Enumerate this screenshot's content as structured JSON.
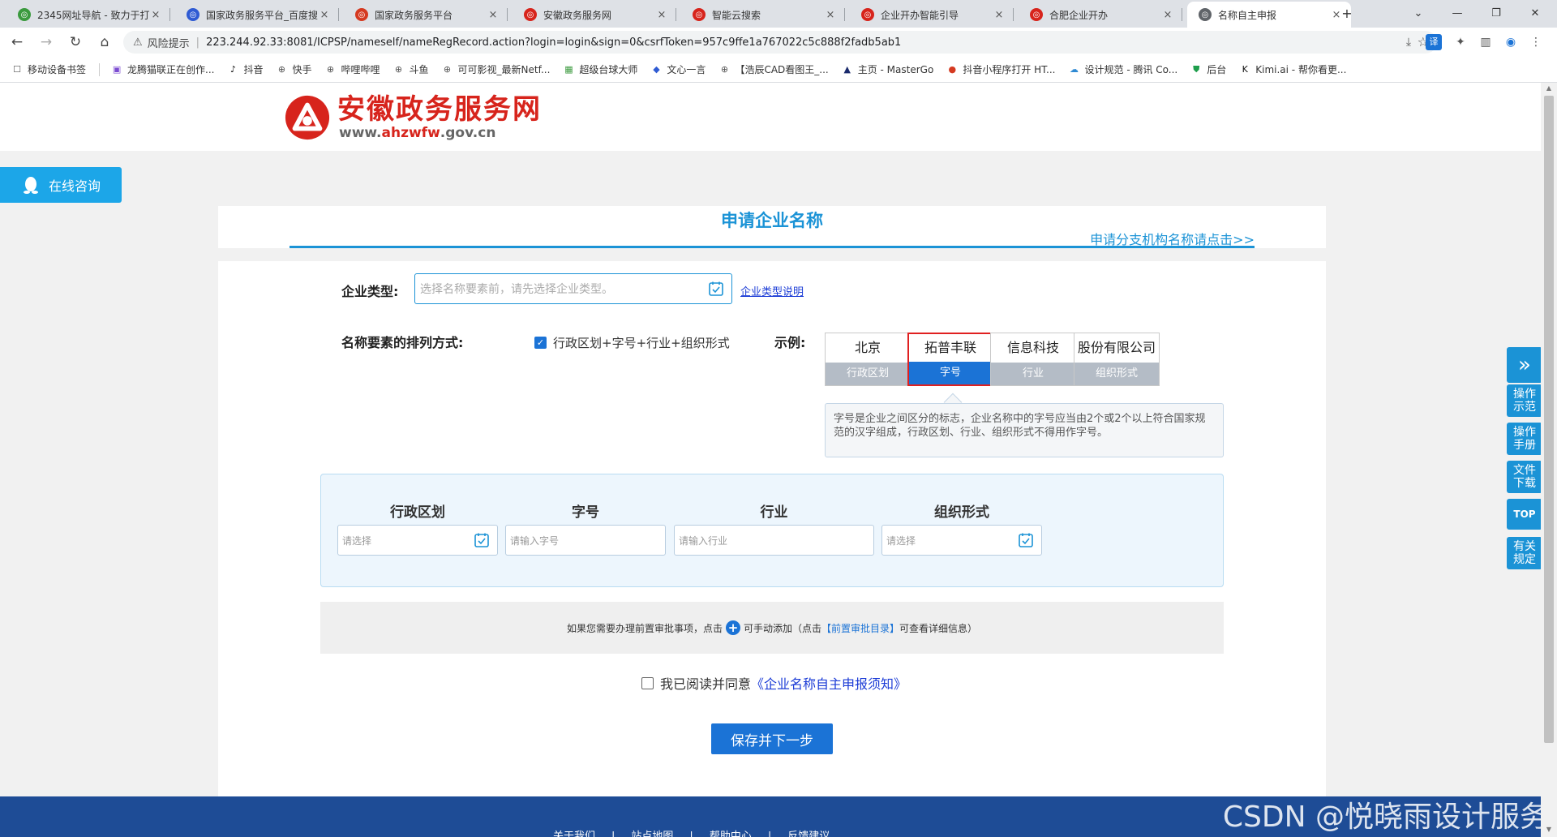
{
  "browser": {
    "tabs": [
      {
        "title": "2345网址导航 - 致力于打",
        "icon_color": "#3b9a3e"
      },
      {
        "title": "国家政务服务平台_百度搜",
        "icon_color": "#2f5bd3"
      },
      {
        "title": "国家政务服务平台",
        "icon_color": "#d53a21"
      },
      {
        "title": "安徽政务服务网",
        "icon_color": "#d7241c"
      },
      {
        "title": "智能云搜索",
        "icon_color": "#d7241c"
      },
      {
        "title": "企业开办智能引导",
        "icon_color": "#d7241c"
      },
      {
        "title": "合肥企业开办",
        "icon_color": "#d7241c"
      },
      {
        "title": "名称自主申报",
        "icon_color": "#5f6368"
      }
    ],
    "close_glyph": "×",
    "new_tab_glyph": "+",
    "security_label": "风险提示",
    "url": "223.244.92.33:8081/ICPSP/nameself/nameRegRecord.action?login=login&sign=0&csrfToken=957c9ffe1a767022c5c888f2fadb5ab1",
    "bookmarks": [
      {
        "label": "移动设备书签",
        "icon": "folder-icon"
      },
      {
        "label": "龙腾猫联正在创作...",
        "icon": "bookmark-icon"
      },
      {
        "label": "抖音",
        "icon": "tiktok-icon"
      },
      {
        "label": "快手",
        "icon": "globe-icon"
      },
      {
        "label": "哔哩哔哩",
        "icon": "globe-icon"
      },
      {
        "label": "斗鱼",
        "icon": "globe-icon"
      },
      {
        "label": "可可影视_最新Netf...",
        "icon": "globe-icon"
      },
      {
        "label": "超级台球大师",
        "icon": "game-icon"
      },
      {
        "label": "文心一言",
        "icon": "wenxin-icon"
      },
      {
        "label": "【浩辰CAD看图王_...",
        "icon": "globe-icon"
      },
      {
        "label": "主页 - MasterGo",
        "icon": "mastergo-icon"
      },
      {
        "label": "抖音小程序打开 HT...",
        "icon": "person-icon"
      },
      {
        "label": "设计规范 - 腾讯 Co...",
        "icon": "tencent-icon"
      },
      {
        "label": "后台",
        "icon": "shield-icon"
      },
      {
        "label": "Kimi.ai - 帮你看更...",
        "icon": "kimi-icon"
      }
    ]
  },
  "site": {
    "logo_cn": "安徽政务服务网",
    "logo_en_prefix": "www.",
    "logo_en_brand": "ahzwfw",
    "logo_en_suffix": ".gov.cn",
    "brand_color": "#d7241c",
    "online_consult": "在线咨询",
    "page_title": "申请企业名称",
    "branch_link": "申请分支机构名称请点击>>"
  },
  "form": {
    "type_label": "企业类型:",
    "type_placeholder": "选择名称要素前，请先选择企业类型。",
    "type_help": "企业类型说明",
    "order_label": "名称要素的排列方式:",
    "order_option": "行政区划+字号+行业+组织形式",
    "order_checked": true,
    "example_label": "示例:",
    "examples": [
      {
        "value": "北京",
        "tag": "行政区划",
        "highlight": false
      },
      {
        "value": "拓普丰联",
        "tag": "字号",
        "highlight": true
      },
      {
        "value": "信息科技",
        "tag": "行业",
        "highlight": false
      },
      {
        "value": "股份有限公司",
        "tag": "组织形式",
        "highlight": false
      }
    ],
    "example_tip": "字号是企业之间区分的标志，企业名称中的字号应当由2个或2个以上符合国家规范的汉字组成，行政区划、行业、组织形式不得用作字号。",
    "elements": [
      {
        "header": "行政区划",
        "placeholder": "请选择",
        "has_picker": true
      },
      {
        "header": "字号",
        "placeholder": "请输入字号",
        "has_picker": false
      },
      {
        "header": "行业",
        "placeholder": "请输入行业",
        "has_picker": false
      },
      {
        "header": "组织形式",
        "placeholder": "请选择",
        "has_picker": true
      }
    ],
    "note_before": "如果您需要办理前置审批事项，点击",
    "note_middle": "可手动添加（点击",
    "note_link": "【前置审批目录】",
    "note_after": "可查看详细信息）",
    "agree_text": "我已阅读并同意",
    "agree_link": "《企业名称自主申报须知》",
    "agree_checked": false,
    "save_button": "保存并下一步"
  },
  "right_tools": [
    {
      "label": "»",
      "kind": "expand"
    },
    {
      "label": "操作示范",
      "kind": "text"
    },
    {
      "label": "操作手册",
      "kind": "text"
    },
    {
      "label": "文件下载",
      "kind": "text"
    },
    {
      "label": "TOP",
      "kind": "top"
    },
    {
      "label": "有关规定",
      "kind": "text"
    }
  ],
  "footer": {
    "links": [
      "关于我们",
      "站点地图",
      "帮助中心",
      "反馈建议"
    ]
  },
  "watermark": "CSDN @悦晓雨设计服务",
  "accent_color": "#1b93d6"
}
